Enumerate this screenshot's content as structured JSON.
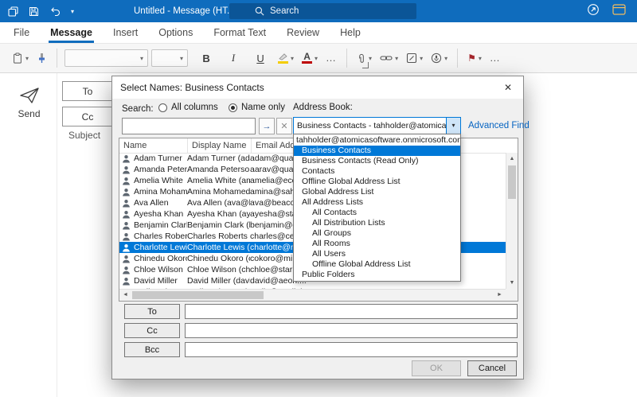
{
  "icons": {
    "chevron_down": "▾",
    "ellipsis": "…",
    "bold": "B",
    "italic": "I",
    "underline": "U",
    "font_color_letter": "A",
    "flag": "⚑",
    "close": "✕",
    "go": "→",
    "clear": "✕",
    "up": "▲",
    "down": "▼",
    "left": "◄",
    "right": "►"
  },
  "titlebar": {
    "title": "Untitled  -  Message (HT...",
    "search_text": "Search"
  },
  "ribbon": {
    "tabs": [
      {
        "label": "File"
      },
      {
        "label": "Message",
        "selected": true
      },
      {
        "label": "Insert"
      },
      {
        "label": "Options"
      },
      {
        "label": "Format Text"
      },
      {
        "label": "Review"
      },
      {
        "label": "Help"
      }
    ]
  },
  "compose": {
    "send_label": "Send",
    "to_label": "To",
    "cc_label": "Cc",
    "subject_label": "Subject"
  },
  "dialog": {
    "title": "Select Names: Business Contacts",
    "search_label": "Search:",
    "radio_all_columns": "All columns",
    "radio_name_only": "Name only",
    "address_book_label": "Address Book:",
    "address_book_value": "Business Contacts - tahholder@atomicasoftware",
    "advanced_find_label": "Advanced Find",
    "address_book_options": [
      {
        "label": "tahholder@atomicasoftware.onmicrosoft.com",
        "indent": 0
      },
      {
        "label": "Business Contacts",
        "indent": 1,
        "selected": true
      },
      {
        "label": "Business Contacts (Read Only)",
        "indent": 1
      },
      {
        "label": "Contacts",
        "indent": 1
      },
      {
        "label": "Offline Global Address List",
        "indent": 1
      },
      {
        "label": "Global Address List",
        "indent": 1
      },
      {
        "label": "All Address Lists",
        "indent": 1
      },
      {
        "label": "All Contacts",
        "indent": 2
      },
      {
        "label": "All Distribution Lists",
        "indent": 2
      },
      {
        "label": "All Groups",
        "indent": 2
      },
      {
        "label": "All Rooms",
        "indent": 2
      },
      {
        "label": "All Users",
        "indent": 2
      },
      {
        "label": "Offline Global Address List",
        "indent": 2
      },
      {
        "label": "Public Folders",
        "indent": 1
      }
    ],
    "columns": [
      "Name",
      "Display Name",
      "Email Address"
    ],
    "contacts": [
      {
        "name": "Adam Turner",
        "display": "Adam Turner (ada...",
        "email": "adam@quant..."
      },
      {
        "name": "Amanda Peterson",
        "display": "Amanda Peterson ...",
        "email": "aarav@quant..."
      },
      {
        "name": "Amelia White",
        "display": "Amelia White (am...",
        "email": "amelia@ecov..."
      },
      {
        "name": "Amina Moham...",
        "display": "Amina Mohamed (...",
        "email": "amina@saha..."
      },
      {
        "name": "Ava Allen",
        "display": "Ava Allen (ava@b...",
        "email": "ava@beacon..."
      },
      {
        "name": "Ayesha Khan",
        "display": "Ayesha Khan (ayes...",
        "email": "ayesha@starl..."
      },
      {
        "name": "Benjamin Clark",
        "display": "Benjamin Clark (be...",
        "email": "benjamin@cr..."
      },
      {
        "name": "Charles Roberts",
        "display": "Charles Roberts (c...",
        "email": "charles@ceda..."
      },
      {
        "name": "Charlotte Lewis",
        "display": "Charlotte Lewis (c...",
        "email": "charlotte@nim...",
        "selected": true
      },
      {
        "name": "Chinedu Okoro",
        "display": "Chinedu Okoro (c...",
        "email": "cokoro@miles..."
      },
      {
        "name": "Chloe Wilson",
        "display": "Chloe Wilson (chlo...",
        "email": "chloe@starlig..."
      },
      {
        "name": "David Miller",
        "display": "David Miller (david...",
        "email": "david@aeon...."
      },
      {
        "name": "Emily Johnson",
        "display": "Emily Johnson (em...",
        "email": "emily@starligh..."
      }
    ],
    "to_label": "To",
    "cc_label": "Cc",
    "bcc_label": "Bcc",
    "ok_label": "OK",
    "cancel_label": "Cancel"
  }
}
